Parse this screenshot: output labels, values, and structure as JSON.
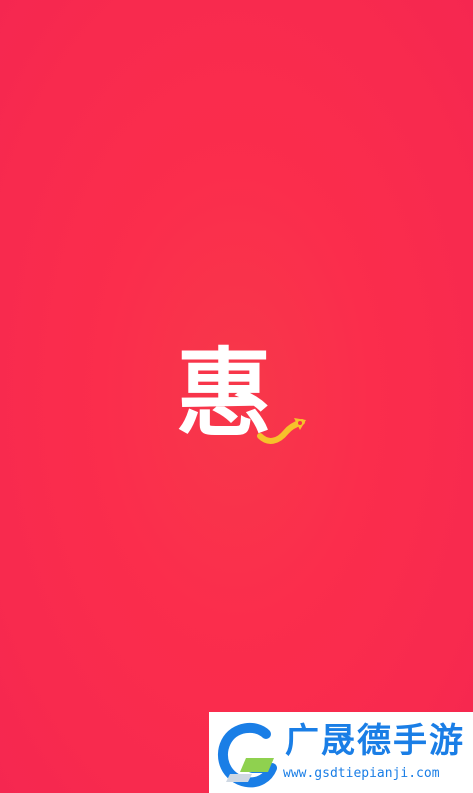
{
  "splash": {
    "logo_char": "惠",
    "background_color": "#fb2d4c",
    "logo_accent_color": "#f6c12b"
  },
  "watermark": {
    "title": "广晟德手游",
    "url": "www.gsdtiepianji.com",
    "brand_color": "#1a7ee6",
    "logo_icon": "gsd-logo-icon"
  }
}
